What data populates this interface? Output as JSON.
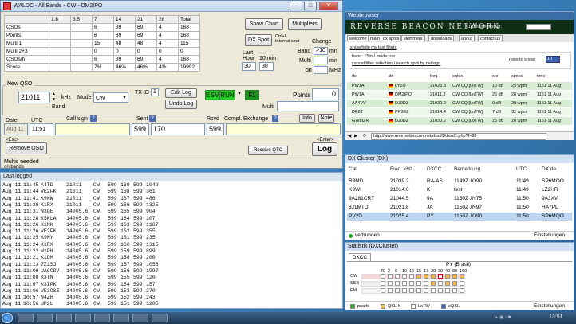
{
  "waldc": {
    "title": "WALDC - All Bands - CW - DM2IPO",
    "score_table": {
      "headers": [
        "",
        "1.8",
        "3.5",
        "7",
        "14",
        "21",
        "28",
        "Total"
      ],
      "rows": [
        {
          "label": "QSOs",
          "values": [
            "",
            "",
            "6",
            "89",
            "69",
            "4",
            "168"
          ]
        },
        {
          "label": "Points",
          "values": [
            "",
            "",
            "6",
            "89",
            "69",
            "4",
            "168"
          ]
        },
        {
          "label": "Multi 1",
          "values": [
            "",
            "",
            "15",
            "48",
            "48",
            "4",
            "115"
          ]
        },
        {
          "label": "Multi 2+3",
          "values": [
            "",
            "",
            "0",
            "0",
            "0",
            "0",
            "0"
          ]
        },
        {
          "label": "QSOs/h",
          "values": [
            "",
            "",
            "6",
            "89",
            "69",
            "4",
            "168"
          ]
        },
        {
          "label": "Score",
          "values": [
            "",
            "",
            "7%",
            "46%",
            "46%",
            "4%",
            "19992"
          ]
        }
      ]
    },
    "buttons": {
      "show_chart": "Show Chart",
      "multipliers": "Multipliers",
      "dx_spot": "DX Spot",
      "ctrl_internal": "Ctrl+I\nInternal spot",
      "edit_log": "Edit Log",
      "undo_log": "Undo Log",
      "remove_qso": "Remove QSO",
      "receive_qtc": "Receive QTC",
      "info": "Info",
      "note": "Note",
      "log": "Log"
    },
    "change": {
      "label": "Change",
      "band_label": "Band",
      "band_value": ">10",
      "band_unit": "mn",
      "multi_label": "Multi",
      "multi_unit": "mn",
      "on_label": "on",
      "mhz": "MHz"
    },
    "rates": {
      "last_hour_label": "Last\nHour",
      "ten_min_label": "10 min",
      "last_hour_value": "30",
      "ten_min_value": "30"
    },
    "new_qso": {
      "section": "New QSO",
      "frequency": "21011",
      "khz": "kHz",
      "band": "Band",
      "mode_label": "Mode",
      "mode_value": "CW",
      "tx_id_label": "TX ID",
      "tx_id_value": "1",
      "esm": "ESM",
      "run": "RUN",
      "f1": "F1",
      "points_label": "Points",
      "points_value": "0",
      "multi_label": "Multi",
      "multi_value": ""
    },
    "qso_entry": {
      "date_label": "Date",
      "time_label": "UTC",
      "callsign_label": "Call sign",
      "sent_label": "Sent",
      "rcvd_label": "Rcvd",
      "compl_label": "Compl.",
      "exchange_label": "Exchange",
      "date_value": "Aug 11",
      "time_value": "11:51",
      "callsign_value": "",
      "sent_rst": "599",
      "sent_nr": "170",
      "rcvd_rst": "599",
      "rcvd_exchange": "",
      "esc": "<Esc>",
      "enter": "<Enter>"
    },
    "status": {
      "multis_needed": "Multis needed",
      "no_bands": "on bands"
    }
  },
  "last_logged": {
    "title": "Last logged",
    "rows": [
      [
        "Aug 11",
        "11:45",
        "K4TD",
        "21011",
        "CW",
        "599",
        "169",
        "599",
        "1049"
      ],
      [
        "Aug 11",
        "11:44",
        "VE2FK",
        "21011",
        "CW",
        "599",
        "168",
        "599",
        "361"
      ],
      [
        "Aug 11",
        "11:41",
        "K9MW",
        "21011",
        "CW",
        "599",
        "167",
        "599",
        "486"
      ],
      [
        "Aug 11",
        "11:39",
        "K1RX",
        "21011",
        "CW",
        "599",
        "166",
        "599",
        "1325"
      ],
      [
        "Aug 11",
        "11:31",
        "N3QE",
        "14005.6",
        "CW",
        "599",
        "165",
        "599",
        "904"
      ],
      [
        "Aug 11",
        "11:28",
        "K5KLA",
        "14005.6",
        "CW",
        "599",
        "164",
        "599",
        "107"
      ],
      [
        "Aug 11",
        "11:26",
        "K1MK",
        "14005.6",
        "CW",
        "599",
        "163",
        "599",
        "1187"
      ],
      [
        "Aug 11",
        "11:26",
        "VE2FK",
        "14005.6",
        "CW",
        "599",
        "162",
        "599",
        "355"
      ],
      [
        "Aug 11",
        "11:25",
        "K9MY",
        "14005.6",
        "CW",
        "599",
        "161",
        "599",
        "235"
      ],
      [
        "Aug 11",
        "11:24",
        "K1RX",
        "14005.6",
        "CW",
        "599",
        "160",
        "599",
        "1315"
      ],
      [
        "Aug 11",
        "11:22",
        "W1PH",
        "14005.6",
        "CW",
        "599",
        "159",
        "599",
        "899"
      ],
      [
        "Aug 11",
        "11:21",
        "K1DM",
        "14005.6",
        "CW",
        "599",
        "158",
        "599",
        "200"
      ],
      [
        "Aug 11",
        "11:13",
        "7Z1SJ",
        "14005.6",
        "CW",
        "599",
        "157",
        "599",
        "1056"
      ],
      [
        "Aug 11",
        "11:09",
        "UA9CDV",
        "14005.6",
        "CW",
        "599",
        "156",
        "599",
        "1997"
      ],
      [
        "Aug 11",
        "11:08",
        "K3TN",
        "14005.6",
        "CW",
        "599",
        "155",
        "599",
        "120"
      ],
      [
        "Aug 11",
        "11:07",
        "K3IPK",
        "14005.6",
        "CW",
        "599",
        "154",
        "599",
        "157"
      ],
      [
        "Aug 11",
        "11:06",
        "VE3OSZ",
        "14005.6",
        "CW",
        "599",
        "153",
        "599",
        "270"
      ],
      [
        "Aug 11",
        "10:57",
        "N4ZR",
        "14005.6",
        "CW",
        "599",
        "152",
        "599",
        "243"
      ],
      [
        "Aug 11",
        "10:56",
        "UP2L",
        "14005.6",
        "CW",
        "599",
        "151",
        "599",
        "1205"
      ]
    ]
  },
  "webbrowser": {
    "title": "Webbrowser",
    "banner": "REVERSE BEACON NETWORK",
    "callsign_lookup": "K1 callsign lookup:",
    "nav": [
      "welcome",
      "main",
      "dx spots",
      "skimmers",
      "downloads",
      "about",
      "contact us"
    ],
    "show_filters": "show/hide my last filters",
    "filter_line": "band: 15m / mode: cw",
    "cancel_filter": "cancel filter selection / search spot by callsign",
    "rows_to_show_label": "rows to show:",
    "rows_to_show_value": "10",
    "columns": [
      "de",
      "dx",
      "freq",
      "cq/dx",
      "snr",
      "speed",
      "time"
    ],
    "rows": [
      [
        "PW1A",
        "LY2IJ",
        "21026.3",
        "CW CQ [LoTW]",
        "10 dB",
        "29 wpm",
        "1151 11 Aug"
      ],
      [
        "PW1A",
        "DM2IPO",
        "21011.3",
        "CW CQ [LoTW]",
        "25 dB",
        "28 wpm",
        "1151 11 Aug"
      ],
      [
        "AA4VV",
        "DJ0DZ",
        "21030.2",
        "CW CQ [LoTW]",
        "0 dB",
        "29 wpm",
        "1151 11 Aug"
      ],
      [
        "DE8T",
        "PP5EZ",
        "21014.4",
        "CW CQ [LoTW]",
        "7 dB",
        "32 wpm",
        "1151 11 Aug"
      ],
      [
        "GW8IZR",
        "DJ0DZ",
        "21030.2",
        "CW CQ [LoTW]",
        "25 dB",
        "28 wpm",
        "1151 11 Aug"
      ]
    ],
    "url": "http://www.reversebeacon.net/dxsd1/dxsd1.php?f=80"
  },
  "dx_cluster": {
    "title": "DX Cluster (DX)",
    "columns": [
      "Call",
      "Freq. kHz",
      "DXCC",
      "Bemerkung",
      "UTC",
      "DX de"
    ],
    "rows": [
      [
        "R8MD",
        "21039.2",
        "RA-AS",
        "1149Z JO90",
        "11:49",
        "SP6MOO"
      ],
      [
        "K3WI",
        "21014.0",
        "K",
        "test",
        "11:49",
        "LZ2HR"
      ],
      [
        "9A281CRT",
        "21044.5",
        "9A",
        "1150Z JN75",
        "11:50",
        "9A3XV"
      ],
      [
        "8J1MTD",
        "21021.8",
        "JA",
        "1150Z JN97",
        "11:50",
        "HA7PL"
      ],
      [
        "PV2D",
        "21025.4",
        "PY",
        "1150Z JO90",
        "11:50",
        "SP6MQO"
      ]
    ],
    "status": "verbunden",
    "settings": "Einstellungen"
  },
  "statistik": {
    "title": "Statistik (DXCluster)",
    "tab": "DXCC",
    "country": "PY (Brasil)",
    "bands": [
      "70",
      "2",
      "6",
      "10",
      "12",
      "15",
      "17",
      "20",
      "30",
      "40",
      "80",
      "160"
    ],
    "modes": [
      "CW",
      "SSB",
      "FM"
    ],
    "legend": [
      "pearb",
      "QSL-K",
      "LoTW",
      "eQSL"
    ],
    "settings": "Einstellungen"
  },
  "taskbar": {
    "time": "13:51"
  }
}
